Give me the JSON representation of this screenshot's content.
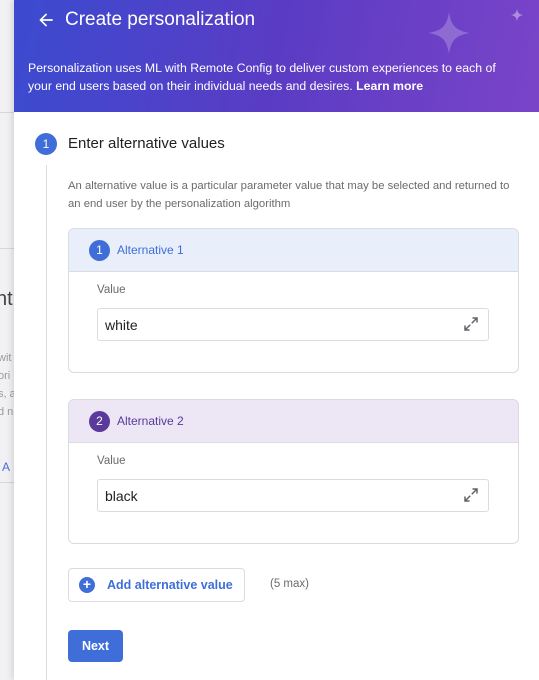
{
  "background": {
    "fragments": [
      "wit",
      "ori",
      "s, a",
      "d n"
    ],
    "big_fragment": "nt",
    "link_fragment": "t A"
  },
  "header": {
    "title": "Create personalization",
    "description": "Personalization uses ML with Remote Config to deliver custom experiences to each of your end users based on their individual needs and desires.",
    "learn_more": "Learn more",
    "back_icon": "arrow-left-icon",
    "sparkle_icon": "sparkle-icon"
  },
  "step": {
    "number": "1",
    "title": "Enter alternative values",
    "description": "An alternative value is a particular parameter value that may be selected and returned to an end user by the personalization algorithm"
  },
  "alternatives": [
    {
      "number": "1",
      "label": "Alternative 1",
      "value_label": "Value",
      "value": "white",
      "color": "#3f6ed8"
    },
    {
      "number": "2",
      "label": "Alternative 2",
      "value_label": "Value",
      "value": "black",
      "color": "#5a3a9a"
    }
  ],
  "add_alternative": {
    "label": "Add alternative value",
    "note": "(5 max)",
    "icon": "plus-circle-icon"
  },
  "next_button": {
    "label": "Next"
  },
  "colors": {
    "accent": "#3f6ed8",
    "header_start": "#3b4bd0",
    "header_end": "#7a44c8"
  }
}
